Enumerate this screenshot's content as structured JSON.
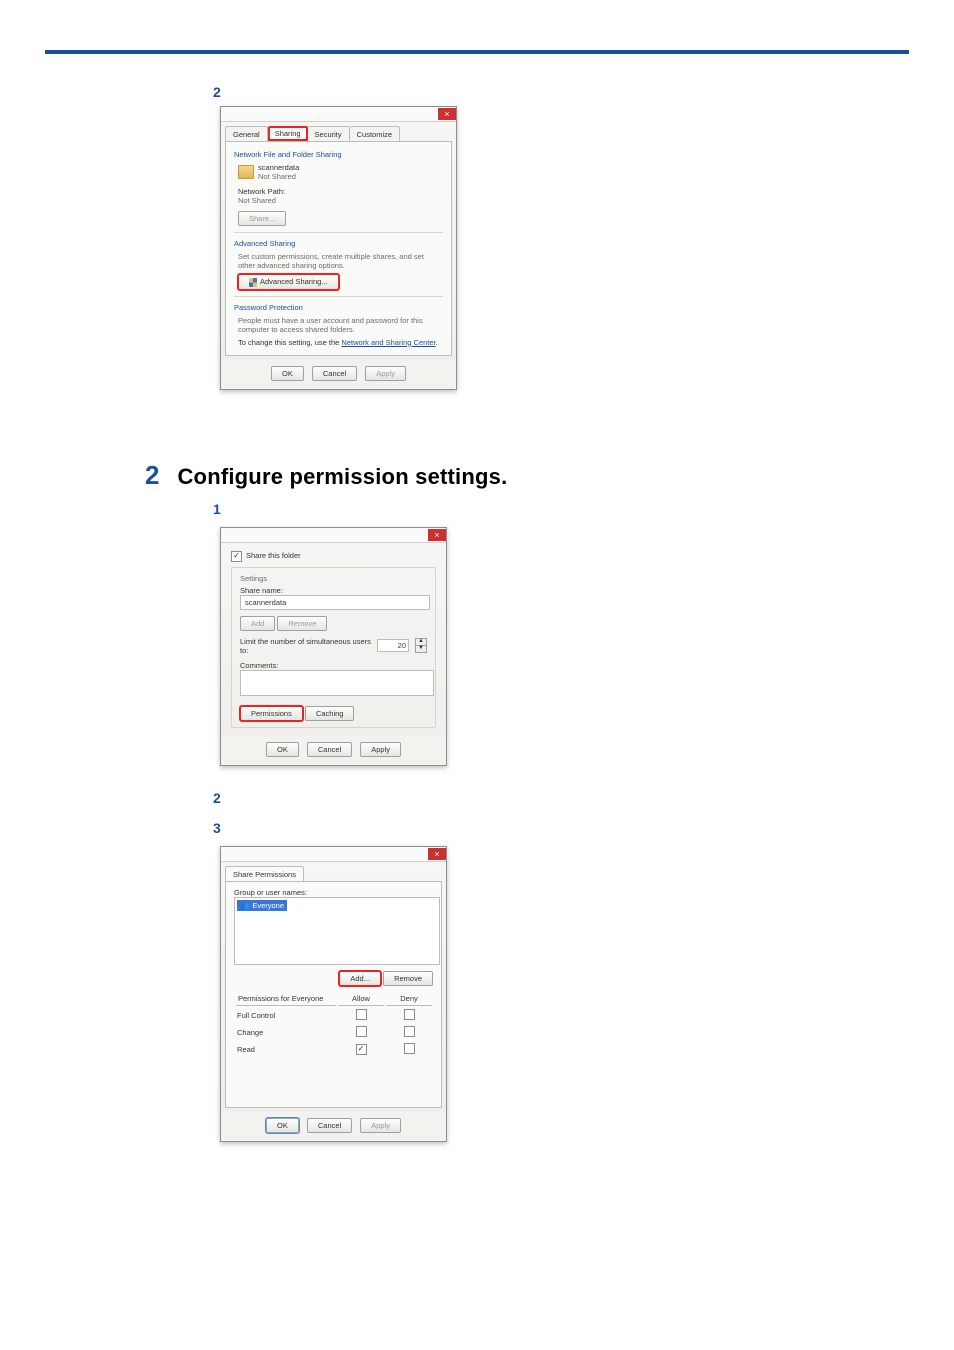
{
  "step_marker_2": "2",
  "heading_num": "2",
  "heading_text": "Configure permission settings.",
  "sub1": "1",
  "sub2": "2",
  "sub3": "3",
  "d1": {
    "tabs": {
      "general": "General",
      "sharing": "Sharing",
      "security": "Security",
      "customize": "Customize"
    },
    "net_title": "Network File and Folder Sharing",
    "folder_name": "scannerdata",
    "folder_status": "Not Shared",
    "net_path_label": "Network Path:",
    "net_path_value": "Not Shared",
    "share_btn": "Share...",
    "adv_title": "Advanced Sharing",
    "adv_desc": "Set custom permissions, create multiple shares, and set other advanced sharing options.",
    "adv_btn": "Advanced Sharing...",
    "pw_title": "Password Protection",
    "pw_desc": "People must have a user account and password for this computer to access shared folders.",
    "pw_change": "To change this setting, use the ",
    "pw_link": "Network and Sharing Center",
    "ok": "OK",
    "cancel": "Cancel",
    "apply": "Apply"
  },
  "d2": {
    "share_chk": "Share this folder",
    "settings": "Settings",
    "share_name_label": "Share name:",
    "share_name_value": "scannerdata",
    "add": "Add",
    "remove": "Remove",
    "limit_label": "Limit the number of simultaneous users to:",
    "limit_value": "20",
    "comments": "Comments:",
    "permissions": "Permissions",
    "caching": "Caching",
    "ok": "OK",
    "cancel": "Cancel",
    "apply": "Apply"
  },
  "d3": {
    "tab": "Share Permissions",
    "group_label": "Group or user names:",
    "everyone": "Everyone",
    "add": "Add...",
    "remove": "Remove",
    "perm_for": "Permissions for Everyone",
    "allow": "Allow",
    "deny": "Deny",
    "rows": {
      "full": "Full Control",
      "change": "Change",
      "read": "Read"
    },
    "ok": "OK",
    "cancel": "Cancel",
    "apply": "Apply"
  }
}
